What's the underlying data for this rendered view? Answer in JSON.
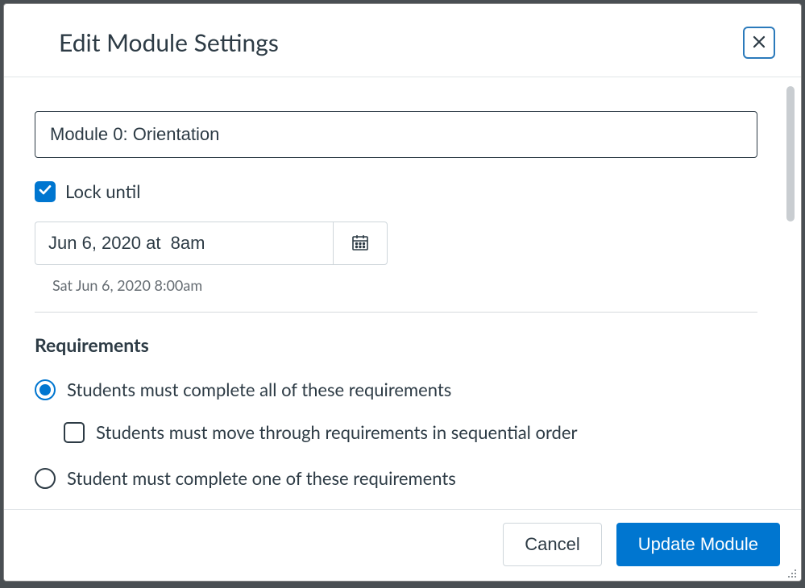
{
  "dialog": {
    "title": "Edit Module Settings"
  },
  "module": {
    "name_value": "Module 0: Orientation"
  },
  "lock": {
    "label": "Lock until",
    "checked": true,
    "date_value": "Jun 6, 2020 at  8am",
    "date_hint": "Sat Jun 6, 2020 8:00am"
  },
  "requirements": {
    "heading": "Requirements",
    "option_all": "Students must complete all of these requirements",
    "sequential_label": "Students must move through requirements in sequential order",
    "sequential_checked": false,
    "option_one": "Student must complete one of these requirements",
    "selected": "all"
  },
  "footer": {
    "cancel": "Cancel",
    "submit": "Update Module"
  }
}
